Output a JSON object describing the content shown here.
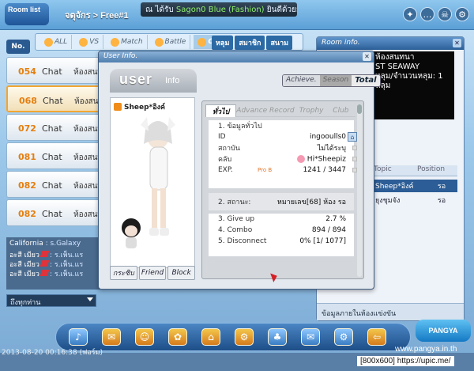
{
  "topbar": {
    "logo": "Room list",
    "breadcrumb": "จตุจักร > Free#1",
    "ticker_prefix": "ณ ได้รับ",
    "ticker_highlight": "Sagon0 Blue (Fashion)",
    "ticker_suffix": "ยินดีด้วยยย",
    "icons": [
      "sparkle-icon",
      "chat-icon",
      "skull-icon",
      "gear-icon"
    ]
  },
  "tabs": {
    "no_label": "No.",
    "items": [
      "ALL",
      "VS",
      "Match",
      "Battle",
      "Chat"
    ],
    "right_items": [
      "หลุม",
      "สมาชิก",
      "สนาม"
    ]
  },
  "rooms": [
    {
      "num": "054",
      "type": "Chat",
      "title": "ห้องสนทนา"
    },
    {
      "num": "068",
      "type": "Chat",
      "title": "ห้องสนทนา"
    },
    {
      "num": "072",
      "type": "Chat",
      "title": "ห้องสนทนา"
    },
    {
      "num": "081",
      "type": "Chat",
      "title": "ห้องสนทนา"
    },
    {
      "num": "082",
      "type": "Chat",
      "title": "ห้องสนทนา"
    },
    {
      "num": "082",
      "type": "Chat",
      "title": "ห้องสนทนา"
    }
  ],
  "chat": {
    "lines": [
      {
        "who": "California",
        "msg": ": s.Galaxy"
      },
      {
        "who": "อะสี เมียว",
        "msg": ": ร.เพ็น.แร"
      },
      {
        "who": "อะสี เมียว",
        "msg": ": ร.เพ็น.แร"
      },
      {
        "who": "อะสี เมียว",
        "msg": ": ร.เพ็น.แร"
      }
    ],
    "input_placeholder": "ถึงทุกท่าน"
  },
  "room_info": {
    "title": "Room info.",
    "desc_lines": [
      "ห้องสนทนา",
      "ST SEAWAY",
      "หลุม/จำนวนหลุม: 1 หลุม"
    ],
    "col_topic": "Topic",
    "col_position": "Position",
    "players": [
      {
        "name": "Sheep*อิงค์",
        "pos": "รอ"
      },
      {
        "name": "ยุงชุมจัง",
        "pos": "รอ"
      }
    ],
    "footer": "ข้อมูลภายในห้องแข่งขัน"
  },
  "user_info": {
    "title": "User Info.",
    "badge_user": "user",
    "badge_info": "Info",
    "modes": [
      "Achieve.",
      "Season",
      "Total"
    ],
    "player_name": "Sheep*อิงค์",
    "avatar_buttons": [
      "กระซิบ",
      "Friend",
      "Block"
    ],
    "tabs": [
      "ทั่วไป",
      "Advance",
      "Record",
      "Trophy",
      "Club"
    ],
    "section1_title": "1. ข้อมูลทั่วไป",
    "fields": [
      {
        "label": "ID",
        "value": "ingooulls0"
      },
      {
        "label": "สถาบัน",
        "value": "ไม่ได้ระบุ"
      },
      {
        "label": "คลับ",
        "value": "Hi*Sheepiz"
      },
      {
        "label": "EXP.",
        "value": "1241 / 3447"
      }
    ],
    "rank_badge": "Pro B",
    "status_label": "2. สถานะ:",
    "status_value": "หมายเลข[68] ห้อง รอ",
    "stats": [
      {
        "label": "3. Give up",
        "value": "2.7 %"
      },
      {
        "label": "4. Combo",
        "value": "894 / 894"
      },
      {
        "label": "5. Disconnect",
        "value": "0% [1/ 1077]"
      }
    ]
  },
  "footer": {
    "timestamp": "2013-08-20 00:16:38 (ฟอร์ม)",
    "brand": "PANGYA",
    "url": "www.pangya.in.th",
    "credit": "[800x600] https://upic.me/"
  }
}
